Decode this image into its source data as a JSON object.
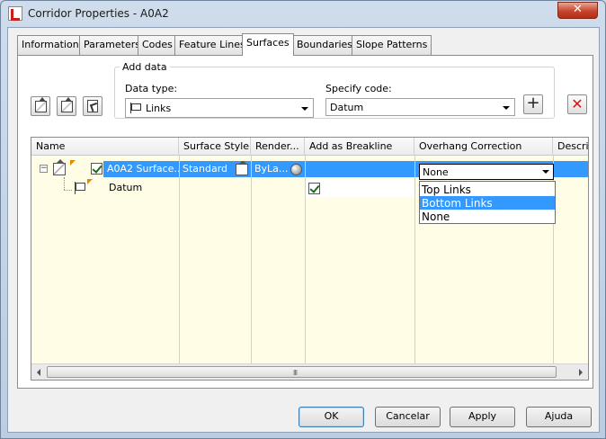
{
  "window": {
    "title": "Corridor Properties - A0A2",
    "close_glyph": "✕"
  },
  "tabs": [
    {
      "label": "Information",
      "active": false
    },
    {
      "label": "Parameters",
      "active": false
    },
    {
      "label": "Codes",
      "active": false
    },
    {
      "label": "Feature Lines",
      "active": false
    },
    {
      "label": "Surfaces",
      "active": true
    },
    {
      "label": "Boundaries",
      "active": false
    },
    {
      "label": "Slope Patterns",
      "active": false
    }
  ],
  "add_data": {
    "group_label": "Add data",
    "data_type_label": "Data type:",
    "data_type_value": "Links",
    "specify_code_label": "Specify code:",
    "specify_code_value": "Datum",
    "add_glyph": "+",
    "delete_glyph": "✕"
  },
  "toolbar_icons": [
    "create-surface-icon",
    "create-surface-from-selection-icon",
    "pick-surface-icon"
  ],
  "grid": {
    "columns": [
      "Name",
      "Surface Style",
      "Render...",
      "Add as Breakline",
      "Overhang Correction",
      "Descrip"
    ],
    "rows": [
      {
        "name": "A0A2 Surface...",
        "surface_style": "Standard",
        "render_material": "ByLa...",
        "add_as_breakline": "",
        "overhang_correction": "None",
        "selected": true,
        "checked": true
      },
      {
        "name": "Datum",
        "surface_style": "",
        "render_material": "",
        "add_as_breakline": true,
        "overhang_correction": "",
        "selected": false
      }
    ],
    "overhang_options": [
      "Top Links",
      "Bottom Links",
      "None"
    ],
    "highlighted_option": "Bottom Links",
    "scroll_grip": "III"
  },
  "buttons": {
    "ok": "OK",
    "cancel": "Cancelar",
    "apply": "Apply",
    "help": "Ajuda"
  },
  "colors": {
    "selection": "#3399ff",
    "grid_background": "#fffde6",
    "delete_red": "#d21616"
  }
}
